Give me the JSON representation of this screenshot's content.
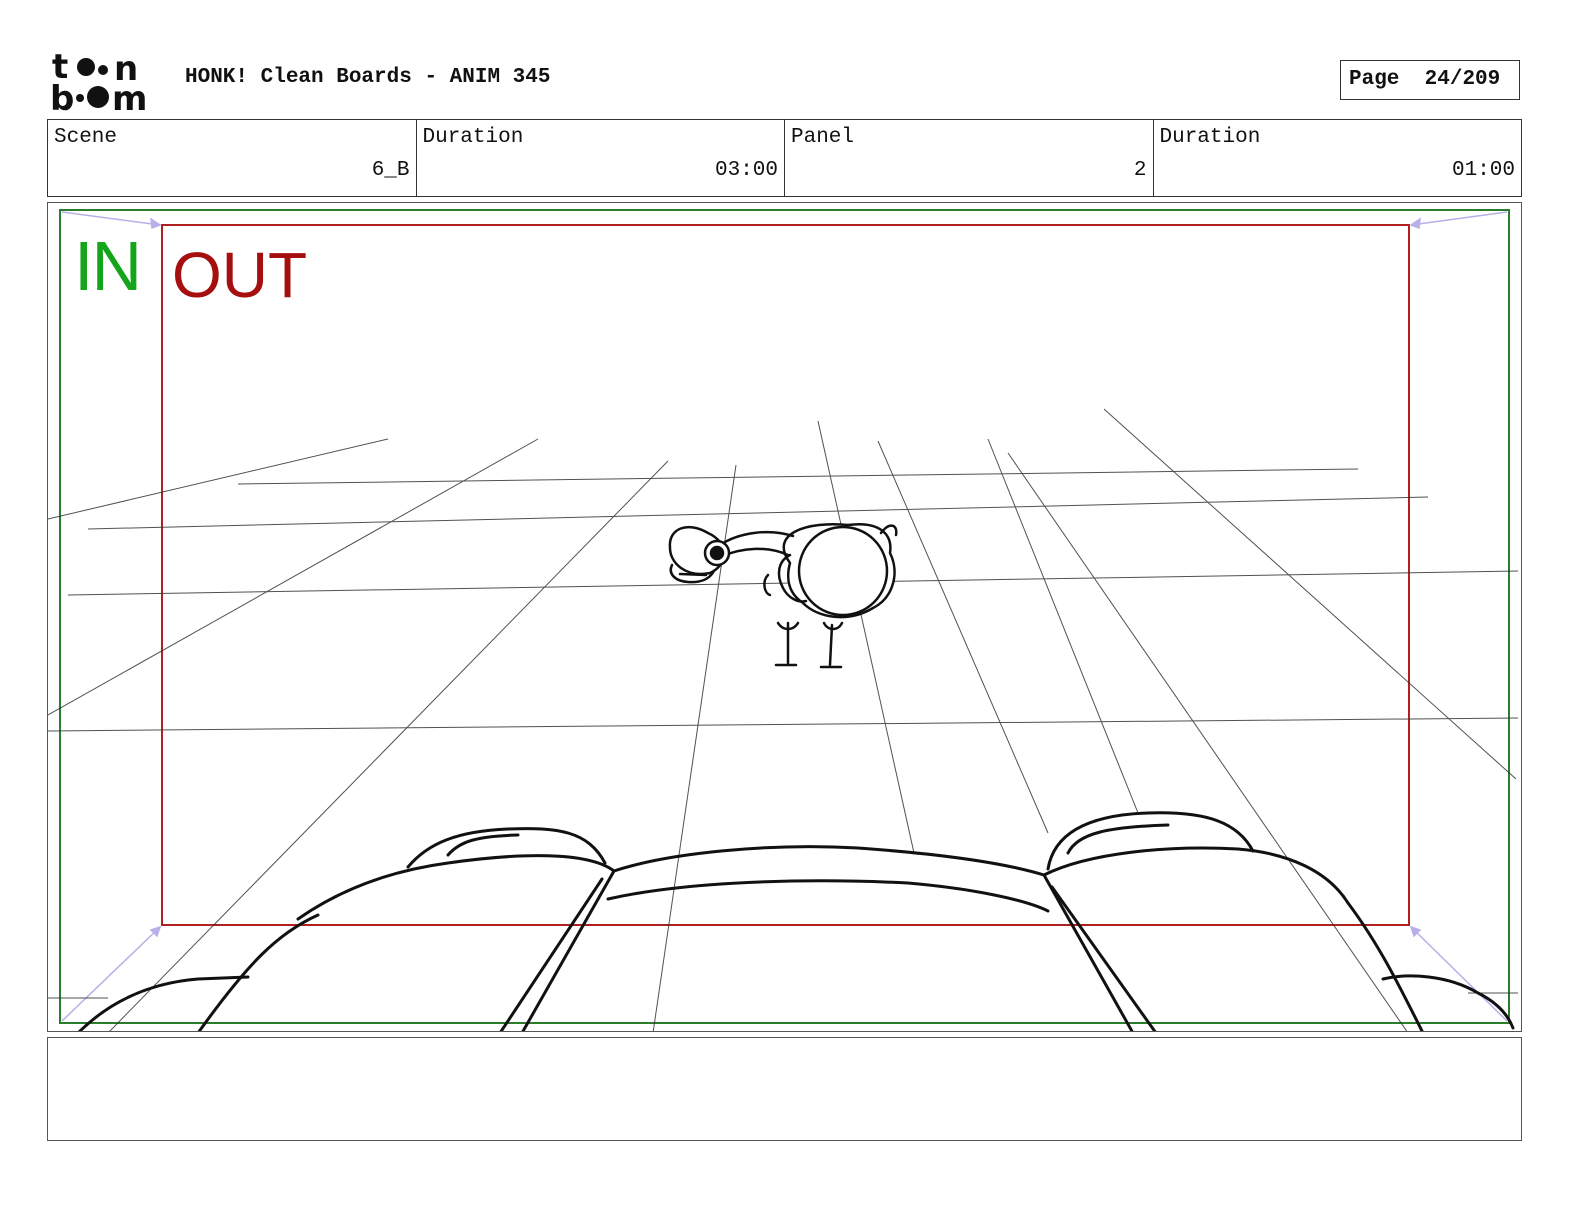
{
  "header": {
    "logo_text_top": "toon",
    "logo_text_bottom": "boom",
    "title": "HONK! Clean Boards - ANIM 345",
    "page_label": "Page",
    "page_number": "24/209"
  },
  "info": [
    {
      "label": "Scene",
      "value": "6_B"
    },
    {
      "label": "Duration",
      "value": "03:00"
    },
    {
      "label": "Panel",
      "value": "2"
    },
    {
      "label": "Duration",
      "value": "01:00"
    }
  ],
  "panel": {
    "in_label": "IN",
    "out_label": "OUT",
    "in_color": "#14a51b",
    "out_color": "#a50f0f"
  },
  "notes": {
    "text": ""
  }
}
